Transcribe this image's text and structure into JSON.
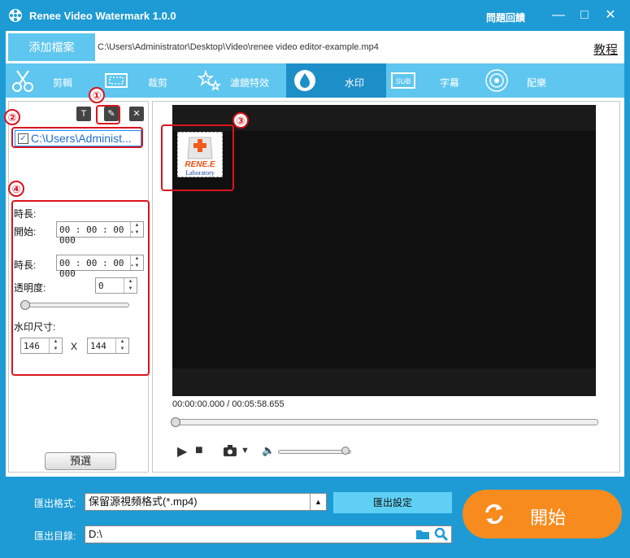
{
  "window": {
    "title": "Renee Video Watermark 1.0.0",
    "feedback": "問題回饋",
    "minimize": "—",
    "maximize": "□",
    "close": "✕"
  },
  "file_row": {
    "add_file": "添加檔案",
    "path": "C:\\Users\\Administrator\\Desktop\\Video\\renee video editor-example.mp4",
    "tutorial": "教程"
  },
  "tabs": [
    {
      "label": "剪輯",
      "icon": "scissors-icon"
    },
    {
      "label": "裁剪",
      "icon": "crop-icon"
    },
    {
      "label": "濾鏡特效",
      "icon": "stars-icon"
    },
    {
      "label": "水印",
      "icon": "water-drop-icon",
      "active": true
    },
    {
      "label": "字幕",
      "icon": "subtitle-icon"
    },
    {
      "label": "配樂",
      "icon": "audio-icon"
    }
  ],
  "left_panel": {
    "watermark_item": "C:\\Users\\Administ...",
    "duration_header": "時長:",
    "start_label": "開始:",
    "start_value": "00 : 00 : 00 . 000",
    "duration_label": "時長:",
    "duration_value": "00 : 00 : 00 . 000",
    "opacity_label": "透明度:",
    "opacity_value": "0",
    "size_label": "水印尺寸:",
    "width_value": "146",
    "height_value": "144",
    "size_separator": "X",
    "preview_button": "預選"
  },
  "markers": [
    "①",
    "②",
    "③",
    "④"
  ],
  "watermark_logo": {
    "line1": "RENE.E",
    "line2": "Laboratory"
  },
  "player": {
    "time": "00:00:00.000 / 00:05:58.655",
    "progress": 0,
    "volume": 0.95
  },
  "bottom": {
    "format_label": "匯出格式:",
    "format_value": "保留源視頻格式(*.mp4)",
    "export_settings": "匯出設定",
    "dir_label": "匯出目錄:",
    "dir_value": "D:\\",
    "start": "開始"
  },
  "colors": {
    "accent": "#1e9bd4",
    "tab_bg": "#5fc6ef",
    "start": "#f88b1e",
    "callout": "#d9141e"
  }
}
